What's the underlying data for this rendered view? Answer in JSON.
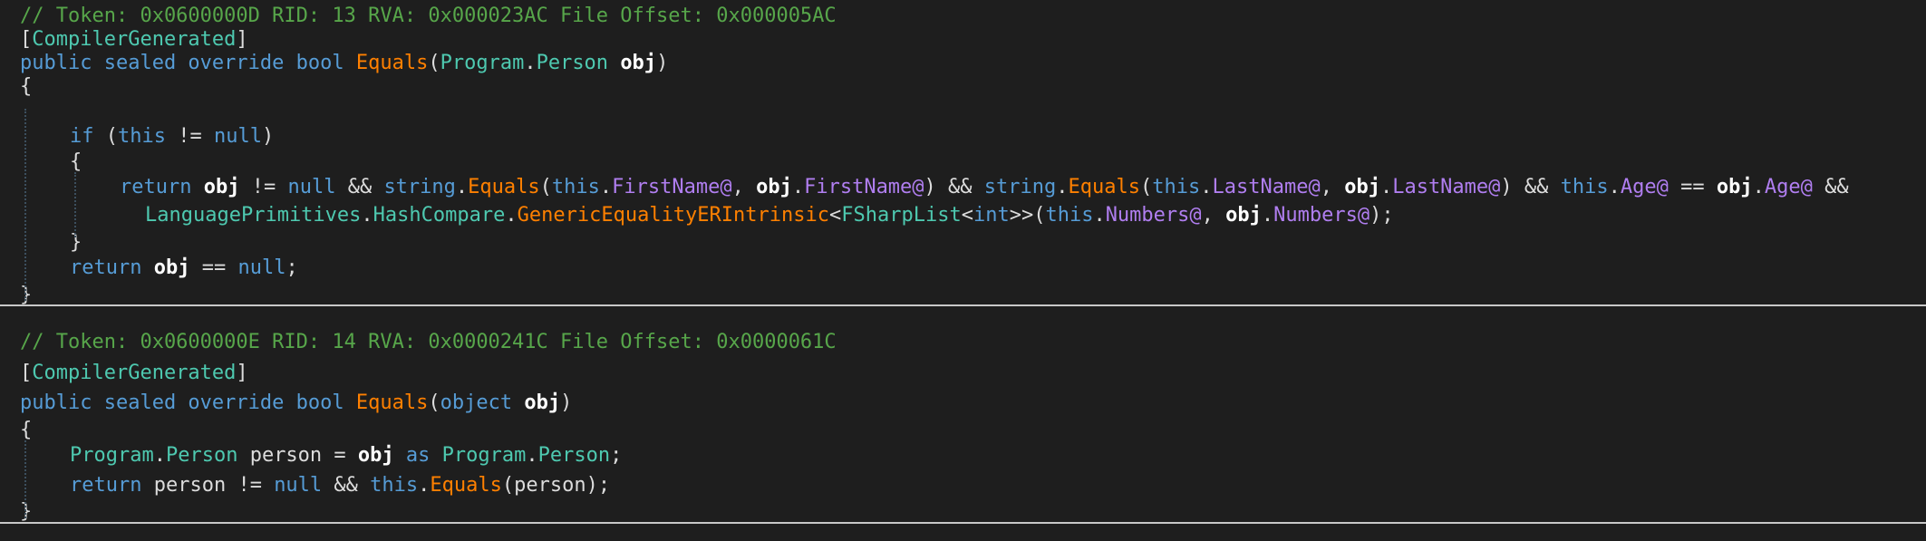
{
  "blocks": [
    {
      "comment": "// Token: 0x0600000D RID: 13 RVA: 0x000023AC File Offset: 0x000005AC",
      "attribute": {
        "open": "[",
        "name": "CompilerGenerated",
        "close": "]"
      },
      "signature": {
        "modifiers": "public sealed override bool",
        "method": "Equals",
        "open_paren": "(",
        "param_ns": "Program",
        "dot": ".",
        "param_type": "Person",
        "param_name": "obj",
        "close_paren": ")"
      },
      "open_brace": "{",
      "if_kw": "if",
      "if_open": " (",
      "this_kw": "this",
      "neq": " != ",
      "null_kw": "null",
      "if_close": ")",
      "inner_open_brace": "{",
      "return_line": {
        "return_kw": "return",
        "obj1": "obj",
        "neq": " != ",
        "null_kw": "null",
        "and1": " && ",
        "string1": "string",
        "dot": ".",
        "equals1": "Equals",
        "open": "(",
        "this1": "this",
        "first_name_a": "FirstName@",
        "comma": ", ",
        "obj2": "obj",
        "first_name_b": "FirstName@",
        "close_and": ") && ",
        "string2": "string",
        "equals2": "Equals",
        "this2": "this",
        "last_name_a": "LastName@",
        "obj3": "obj",
        "last_name_b": "LastName@",
        "this3": "this",
        "age_a": "Age@",
        "eqeq": " == ",
        "obj4": "obj",
        "age_b": "Age@",
        "and_end": " &&"
      },
      "continuation": {
        "type1": "LanguagePrimitives",
        "type2": "HashCompare",
        "method": "GenericEqualityERIntrinsic",
        "lt": "<",
        "list_type": "FSharpList",
        "int_kw": "int",
        "gtgt": ">>",
        "open": "(",
        "this_kw": "this",
        "numbers_a": "Numbers@",
        "comma": ", ",
        "obj": "obj",
        "numbers_b": "Numbers@",
        "end": ");"
      },
      "inner_close_brace": "}",
      "final_return": {
        "return_kw": "return",
        "obj": "obj",
        "eqeq": " == ",
        "null_kw": "null",
        "semi": ";"
      },
      "close_brace": "}"
    },
    {
      "comment": "// Token: 0x0600000E RID: 14 RVA: 0x0000241C File Offset: 0x0000061C",
      "attribute": {
        "open": "[",
        "name": "CompilerGenerated",
        "close": "]"
      },
      "signature": {
        "modifiers": "public sealed override bool",
        "method": "Equals",
        "open_paren": "(",
        "param_type": "object",
        "param_name": "obj",
        "close_paren": ")"
      },
      "open_brace": "{",
      "decl_line": {
        "ns": "Program",
        "dot": ".",
        "type": "Person",
        "var": " person = ",
        "obj": "obj",
        "as_kw": "as",
        "ns2": "Program",
        "type2": "Person",
        "semi": ";"
      },
      "return_line": {
        "return_kw": "return",
        "person": " person != ",
        "null_kw": "null",
        "and": " && ",
        "this_kw": "this",
        "dot": ".",
        "method": "Equals",
        "args": "(person);"
      },
      "close_brace": "}"
    }
  ],
  "colors": {
    "background": "#1e1e1e",
    "comment": "#57a64a",
    "keyword": "#569cd6",
    "type": "#4ec9b0",
    "method": "#ff8000",
    "field": "#b07ef0",
    "separator": "#c8c8c8"
  }
}
